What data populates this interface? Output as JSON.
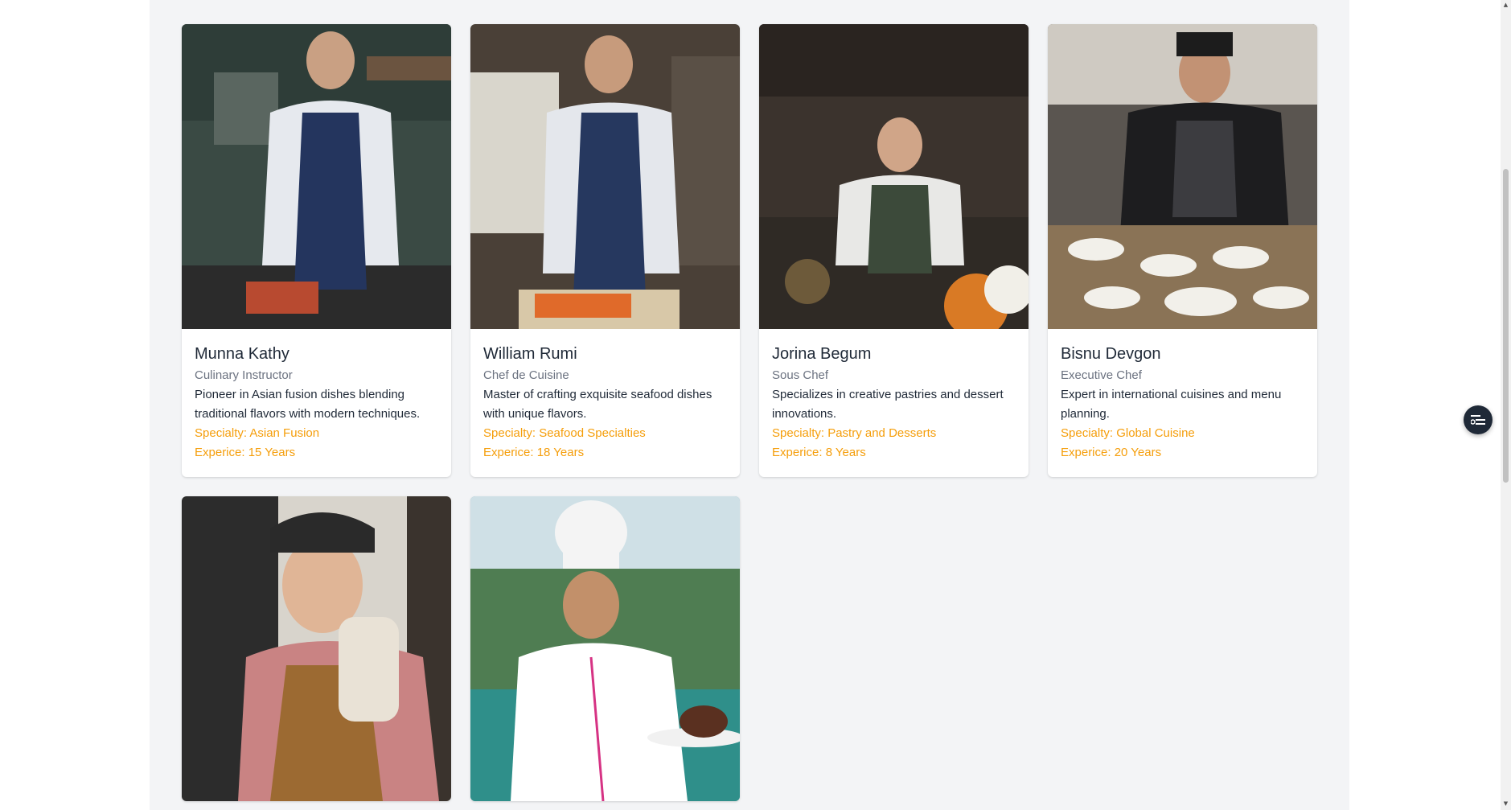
{
  "chefs": [
    {
      "name": "Munna Kathy",
      "role": "Culinary Instructor",
      "bio": "Pioneer in Asian fusion dishes blending traditional flavors with modern techniques.",
      "specialty": "Specialty: Asian Fusion",
      "experience": "Experice: 15 Years"
    },
    {
      "name": "William Rumi",
      "role": "Chef de Cuisine",
      "bio": "Master of crafting exquisite seafood dishes with unique flavors.",
      "specialty": "Specialty: Seafood Specialties",
      "experience": "Experice: 18 Years"
    },
    {
      "name": "Jorina Begum",
      "role": "Sous Chef",
      "bio": "Specializes in creative pastries and dessert innovations.",
      "specialty": "Specialty: Pastry and Desserts",
      "experience": "Experice: 8 Years"
    },
    {
      "name": "Bisnu Devgon",
      "role": "Executive Chef",
      "bio": "Expert in international cuisines and menu planning.",
      "specialty": "Specialty: Global Cuisine",
      "experience": "Experice: 20 Years"
    }
  ],
  "colors": {
    "accent": "#f59e0b",
    "page_background": "#f3f4f6",
    "float_button": "#1f2937"
  },
  "icons": {
    "float_button": "toggle-list-icon"
  }
}
